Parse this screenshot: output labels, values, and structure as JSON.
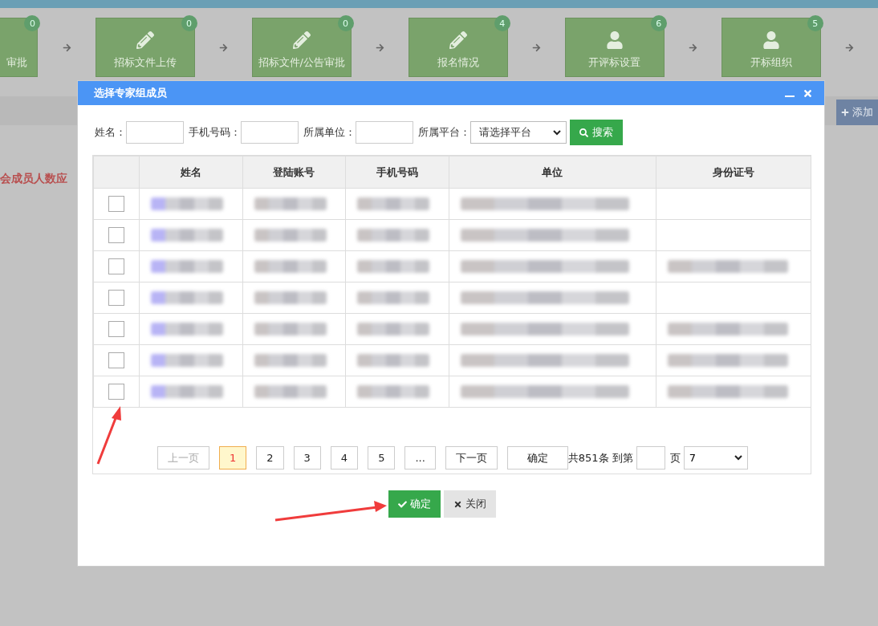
{
  "steps": [
    {
      "label": "审批",
      "count": "0",
      "kind": "cut"
    },
    {
      "label": "招标文件上传",
      "count": "0",
      "kind": "edit"
    },
    {
      "label": "招标文件/公告审批",
      "count": "0",
      "kind": "edit"
    },
    {
      "label": "报名情况",
      "count": "4",
      "kind": "edit"
    },
    {
      "label": "开评标设置",
      "count": "6",
      "kind": "person"
    },
    {
      "label": "开标组织",
      "count": "5",
      "kind": "person"
    }
  ],
  "background": {
    "add_button": "添加",
    "warning": "会成员人数应"
  },
  "dialog": {
    "title": "选择专家组成员",
    "filters": [
      {
        "label": "姓名：",
        "kind": "input"
      },
      {
        "label": "手机号码：",
        "kind": "input"
      },
      {
        "label": "所属单位：",
        "kind": "input"
      },
      {
        "label": "所属平台：",
        "kind": "select",
        "value": "请选择平台"
      }
    ],
    "search_button": "搜索",
    "table": {
      "columns": [
        "姓名",
        "登陆账号",
        "手机号码",
        "单位",
        "身份证号"
      ],
      "rows": [
        {
          "checked": false,
          "id_shown": false
        },
        {
          "checked": false,
          "id_shown": false
        },
        {
          "checked": false,
          "id_shown": true
        },
        {
          "checked": false,
          "id_shown": false
        },
        {
          "checked": false,
          "id_shown": true
        },
        {
          "checked": false,
          "id_shown": true
        },
        {
          "checked": false,
          "id_shown": true
        }
      ]
    },
    "pagination": {
      "prev": "上一页",
      "pages": [
        {
          "label": "1",
          "selected": true
        },
        {
          "label": "2",
          "selected": false
        },
        {
          "label": "3",
          "selected": false
        },
        {
          "label": "4",
          "selected": false
        },
        {
          "label": "5",
          "selected": false
        },
        {
          "label": "...",
          "selected": false
        }
      ],
      "next": "下一页",
      "confirm": "确定",
      "total": "共851条 到第",
      "page_suffix": "页",
      "page_size": "7"
    },
    "buttons": [
      {
        "label": "确定",
        "kind": "primary"
      },
      {
        "label": "关闭",
        "kind": "secondary"
      }
    ]
  }
}
